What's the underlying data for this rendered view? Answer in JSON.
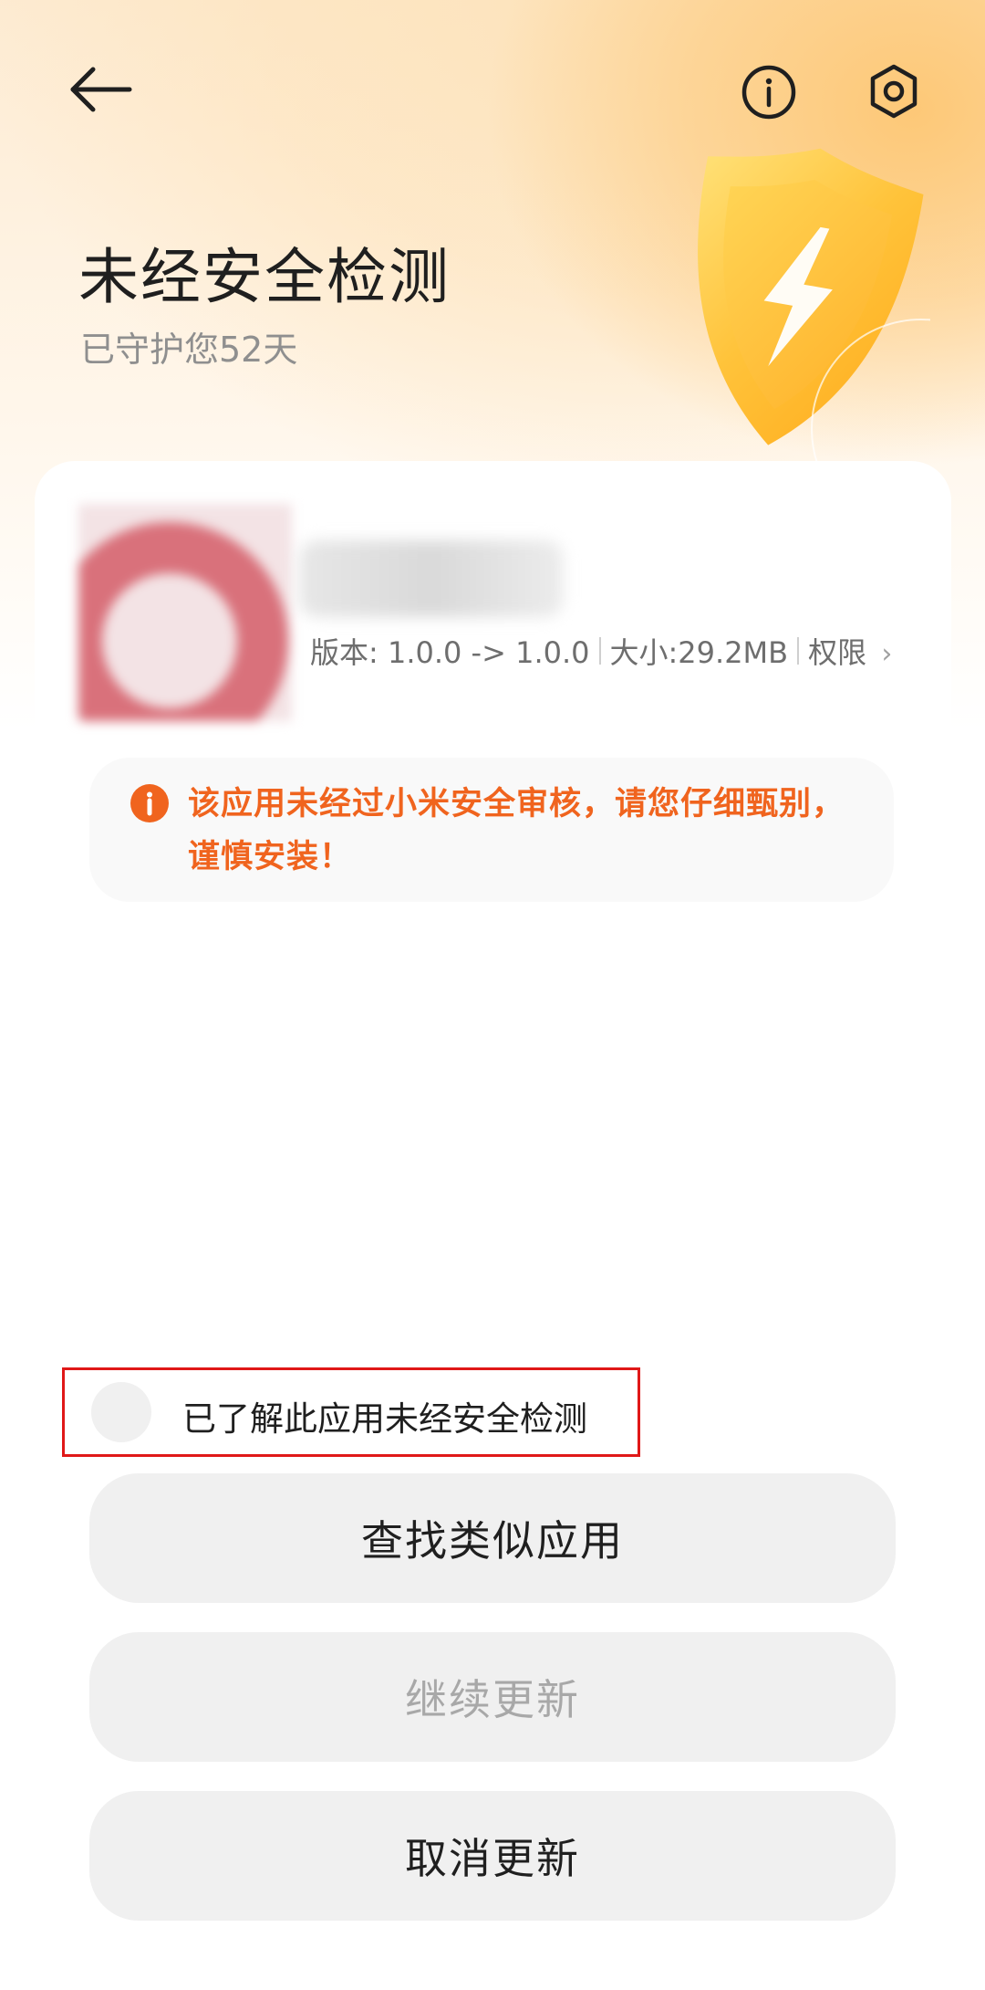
{
  "header": {
    "back_icon": "arrow-left-icon",
    "info_icon": "info-circle-icon",
    "settings_icon": "settings-hexagon-icon",
    "title": "未经安全检测",
    "subtitle": "已守护您52天",
    "shield_icon": "shield-lightning-icon"
  },
  "app": {
    "name": "",
    "version_text": "版本: 1.0.0 -> 1.0.0",
    "size_text": "大小:29.2MB",
    "permissions_label": "权限"
  },
  "warning": {
    "text": "该应用未经过小米安全审核，请您仔细甄别，谨慎安装！",
    "color": "#f0641e"
  },
  "acknowledge": {
    "label": "已了解此应用未经安全检测",
    "checked": false
  },
  "buttons": {
    "find_similar": "查找类似应用",
    "continue_update": "继续更新",
    "cancel_update": "取消更新"
  },
  "colors": {
    "accent_orange": "#f0641e",
    "highlight_border": "#e01818",
    "shield_yellow": "#ffc02e"
  }
}
